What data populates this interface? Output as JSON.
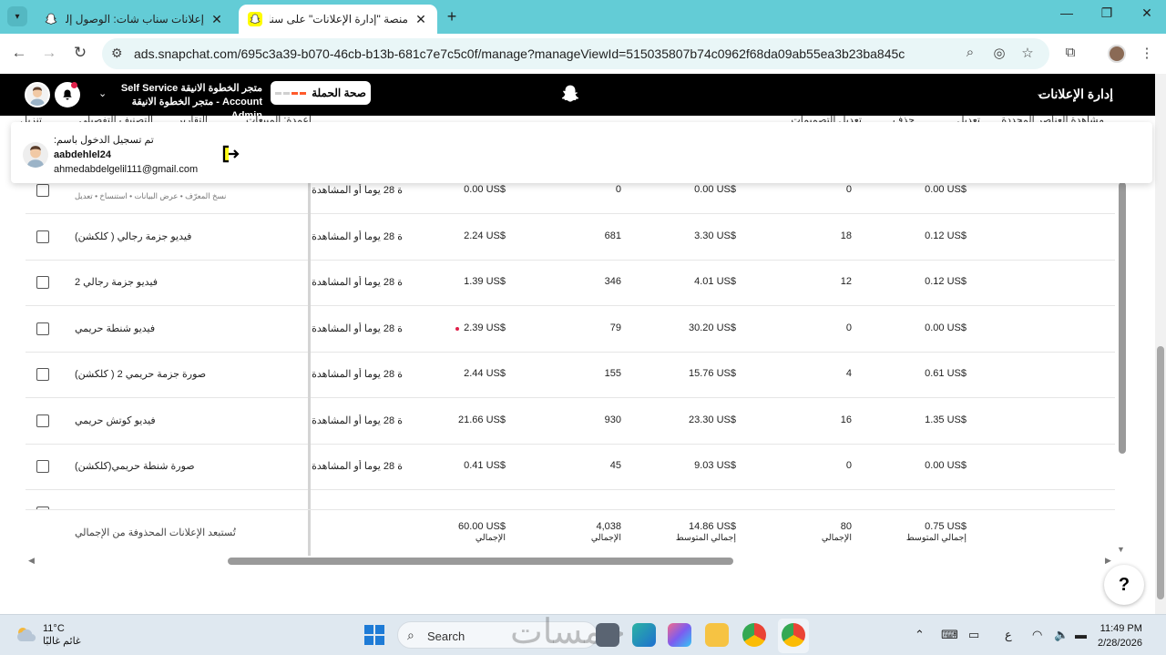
{
  "browser": {
    "tabs": [
      {
        "title": "إعلانات سناب شات: الوصول إلى",
        "active": false
      },
      {
        "title": "منصة \"إدارة الإعلانات\" على سناب",
        "active": true
      }
    ],
    "url": "ads.snapchat.com/695c3a39-b070-46cb-b13b-681c7e7c5c0f/manage?manageViewId=515035807b74c0962f68da09ab55ea3b23ba845c"
  },
  "header": {
    "ads_manager_label": "إدارة الإعلانات",
    "campaign_health_label": "صحة الحملة",
    "account_line1": "Self Service متجر الخطوة الانيقة",
    "account_line2": "متجر الخطوة الانيقة - Account Admin"
  },
  "actions_bar": {
    "view_selected": "مشاهدة العناصر المحددة",
    "edit": "تعديل",
    "delete": "حذف",
    "edit_designs": "تعديل التصميمات",
    "columns": "أعمدة: المبيعات",
    "reports": "التقارير",
    "breakdown": "التصنيف التفصيلي",
    "download": "تنزيل"
  },
  "popup": {
    "logged_in_as": "تم تسجيل الدخول باسم:",
    "username": "aabdehlel24",
    "email": "ahmedabdelgelil111@gmail.com"
  },
  "table": {
    "first_row_sub": "نسخ المعرّف  •  عرض البيانات  •  استنساخ  •  تعديل",
    "rows": [
      {
        "name": "",
        "attr": "ة 28 يوما أو المشاهدة ل",
        "spend": "0.00 US$",
        "impressions": "0",
        "ecpm": "0.00 US$",
        "swipes": "0",
        "cpsu": "0.00 US$"
      },
      {
        "name": "فيديو جزمة رجالي ( كلكشن)",
        "attr": "ة 28 يوما أو المشاهدة ل",
        "spend": "2.24 US$",
        "impressions": "681",
        "ecpm": "3.30 US$",
        "swipes": "18",
        "cpsu": "0.12 US$"
      },
      {
        "name": "فيديو جزمة رجالي 2",
        "attr": "ة 28 يوما أو المشاهدة ل",
        "spend": "1.39 US$",
        "impressions": "346",
        "ecpm": "4.01 US$",
        "swipes": "12",
        "cpsu": "0.12 US$"
      },
      {
        "name": "فيديو شنطة حريمي",
        "attr": "ة 28 يوما أو المشاهدة ل",
        "spend": "2.39 US$",
        "impressions": "79",
        "ecpm": "30.20 US$",
        "swipes": "0",
        "cpsu": "0.00 US$",
        "warning": true
      },
      {
        "name": "صورة جزمة حريمي 2 ( كلكشن)",
        "attr": "ة 28 يوما أو المشاهدة ل",
        "spend": "2.44 US$",
        "impressions": "155",
        "ecpm": "15.76 US$",
        "swipes": "4",
        "cpsu": "0.61 US$"
      },
      {
        "name": "فيديو كوتش حريمي",
        "attr": "ة 28 يوما أو المشاهدة ل",
        "spend": "21.66 US$",
        "impressions": "930",
        "ecpm": "23.30 US$",
        "swipes": "16",
        "cpsu": "1.35 US$"
      },
      {
        "name": "صورة شنطة حريمي(كلكشن)",
        "attr": "ة 28 يوما أو المشاهدة ل",
        "spend": "0.41 US$",
        "impressions": "45",
        "ecpm": "9.03 US$",
        "swipes": "0",
        "cpsu": "0.00 US$"
      }
    ],
    "totals": {
      "note": "تُستبعد الإعلانات المحذوفة من الإجمالي",
      "spend": "60.00 US$",
      "spend_label": "الإجمالي",
      "impressions": "4,038",
      "impressions_label": "الإجمالي",
      "ecpm": "14.86 US$",
      "ecpm_label": "إجمالي المتوسط",
      "swipes": "80",
      "swipes_label": "الإجمالي",
      "cpsu": "0.75 US$",
      "cpsu_label": "إجمالي المتوسط"
    }
  },
  "taskbar": {
    "temperature": "11°C",
    "weather_desc": "غائم غالبًا",
    "search_label": "Search",
    "watermark": "خمسات",
    "lang": "ع",
    "time": "11:49 PM",
    "date": "2/28/2026"
  },
  "colors": {
    "tabstrip": "#63ccd6",
    "snap_yellow": "#fffc00",
    "appbar": "#000000",
    "warning": "#e0204a"
  }
}
